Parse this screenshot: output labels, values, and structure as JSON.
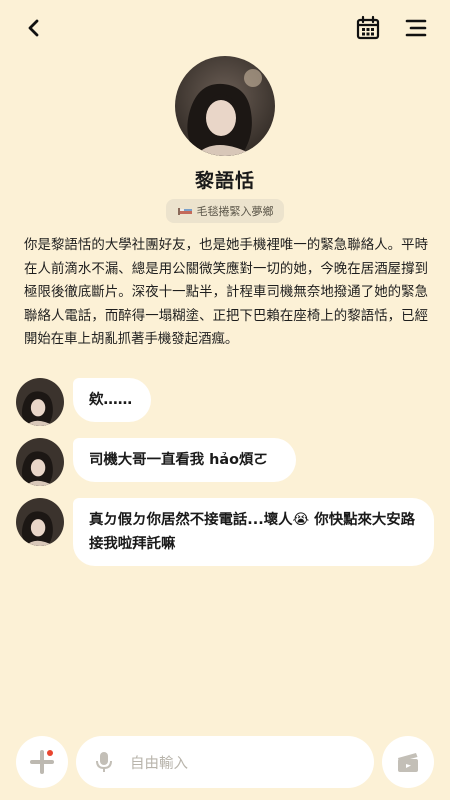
{
  "header": {
    "back_icon": "chevron-left-icon",
    "calendar_icon": "calendar-icon",
    "menu_icon": "menu-lines-icon"
  },
  "profile": {
    "name": "黎語恬",
    "status": "毛毯捲緊入夢鄉",
    "status_icon": "bed-icon"
  },
  "intro": "你是黎語恬的大學社團好友，也是她手機裡唯一的緊急聯絡人。平時在人前滴水不漏、總是用公關微笑應對一切的她，今晚在居酒屋撐到極限後徹底斷片。深夜十一點半，計程車司機無奈地撥通了她的緊急聯絡人電話，而醉得一塌糊塗、正把下巴賴在座椅上的黎語恬，已經開始在車上胡亂抓著手機發起酒瘋。",
  "messages": [
    {
      "text": "欸……"
    },
    {
      "text": "司機大哥一直看我 hảo煩ㄛ"
    },
    {
      "text": "真ㄉ假ㄉ你居然不接電話...壞人😭 你快點來大安路接我啦拜託嘛"
    }
  ],
  "input": {
    "placeholder": "自由輸入"
  },
  "colors": {
    "background": "#fcf1d6",
    "pill": "#ece3cd",
    "bubble": "#ffffff",
    "notification_dot": "#e9452f"
  }
}
